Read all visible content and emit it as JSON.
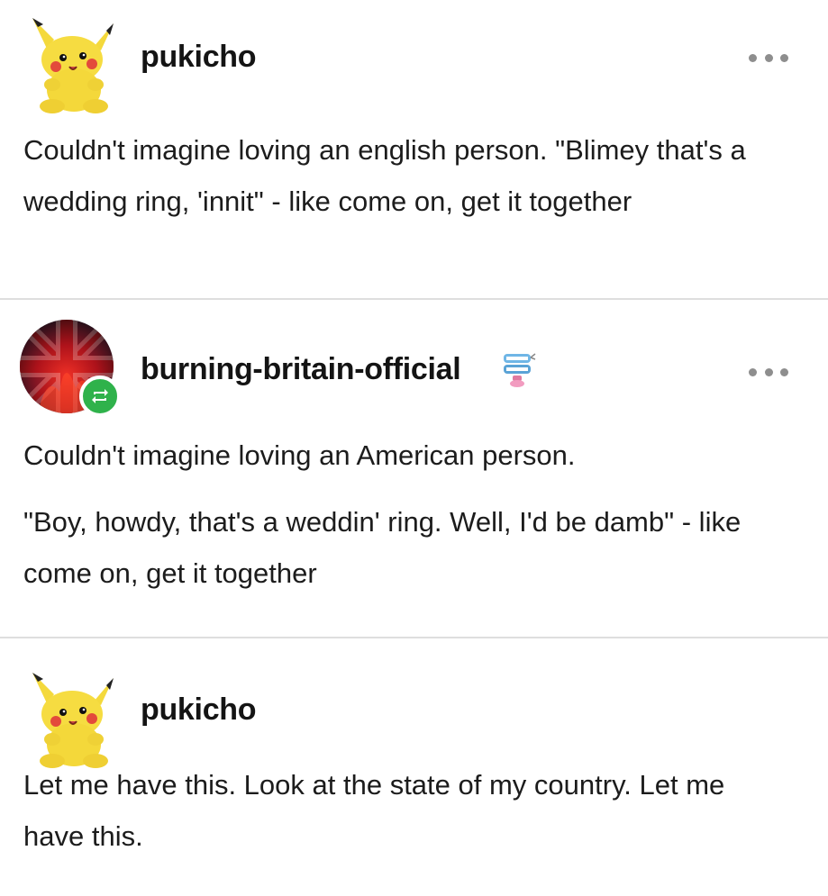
{
  "posts": [
    {
      "username": "pukicho",
      "avatar_icon": "pikachu-plush-icon",
      "text": "Couldn't imagine loving an english person. \"Blimey that's a wedding ring, 'innit\"  - like come on, get it together"
    },
    {
      "username": "burning-britain-official",
      "avatar_icon": "union-jack-fire-icon",
      "badge_icon": "reblog-icon",
      "blog_icon": "chattering-teeth-icon",
      "paragraphs": [
        "Couldn't imagine loving an American person.",
        "\"Boy, howdy, that's a weddin' ring. Well, I'd be damb\" - like come on, get it together"
      ]
    },
    {
      "username": "pukicho",
      "avatar_icon": "pikachu-plush-icon",
      "text": "Let me have this. Look at the state of my country. Let me have this."
    }
  ],
  "colors": {
    "divider": "#dedede",
    "reblog_badge": "#2fb24b",
    "more_dots": "#8e8e8e"
  }
}
